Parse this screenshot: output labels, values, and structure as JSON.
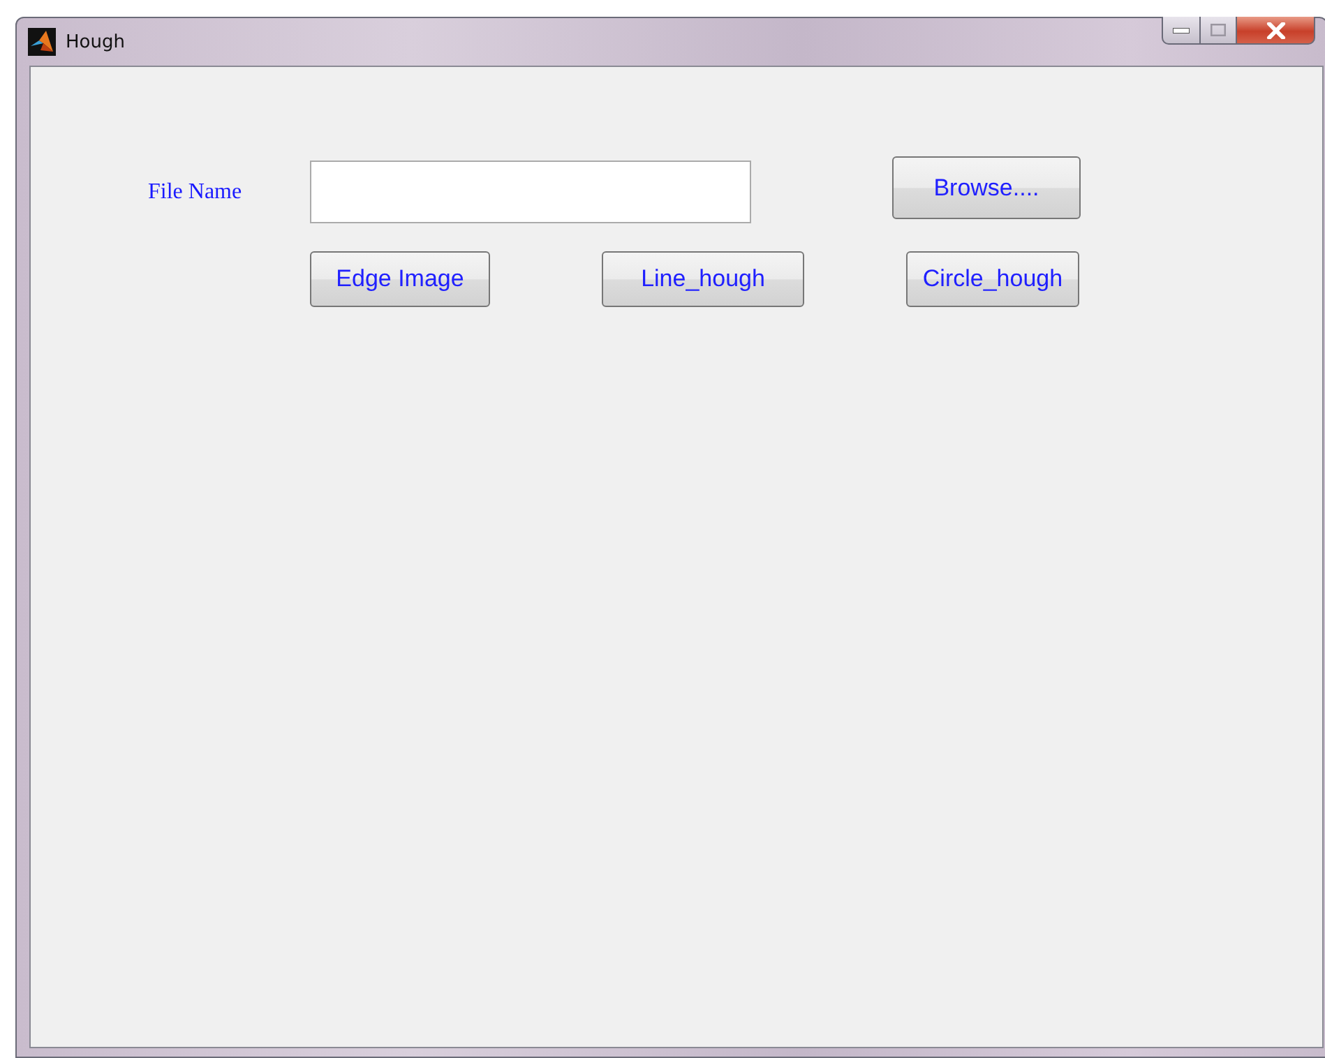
{
  "window": {
    "title": "Hough"
  },
  "file_name": {
    "label": "File Name"
  },
  "buttons": [
    {
      "label": "Browse...."
    },
    {
      "label": "Edge Image"
    },
    {
      "label": "Line_hough"
    },
    {
      "label": "Circle_hough"
    }
  ]
}
